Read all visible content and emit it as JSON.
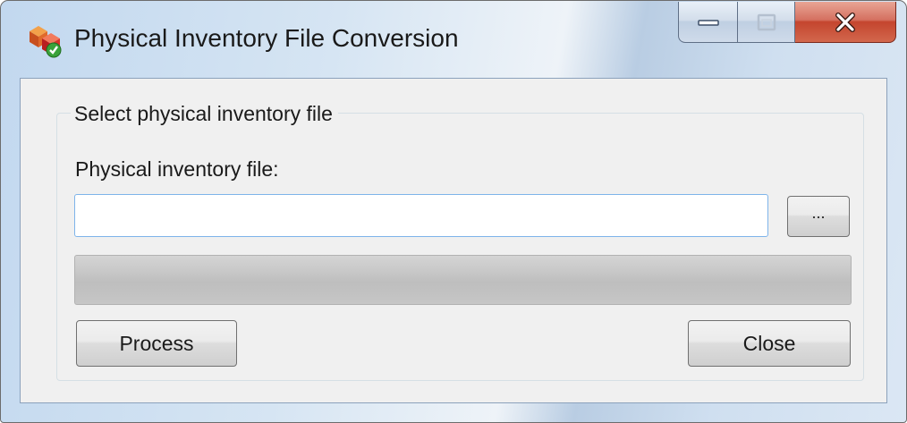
{
  "window": {
    "title": "Physical Inventory File Conversion",
    "icon": "app-icon"
  },
  "caption_buttons": {
    "minimize": "minimize-icon",
    "maximize": "maximize-icon",
    "close": "close-icon"
  },
  "group": {
    "label": "Select physical inventory file",
    "field_label": "Physical inventory file:",
    "file_value": "",
    "browse_label": "...",
    "progress_fraction": 0
  },
  "buttons": {
    "process": "Process",
    "close": "Close"
  },
  "colors": {
    "input_border": "#7eb4ea",
    "close_button": "#c4452e"
  }
}
